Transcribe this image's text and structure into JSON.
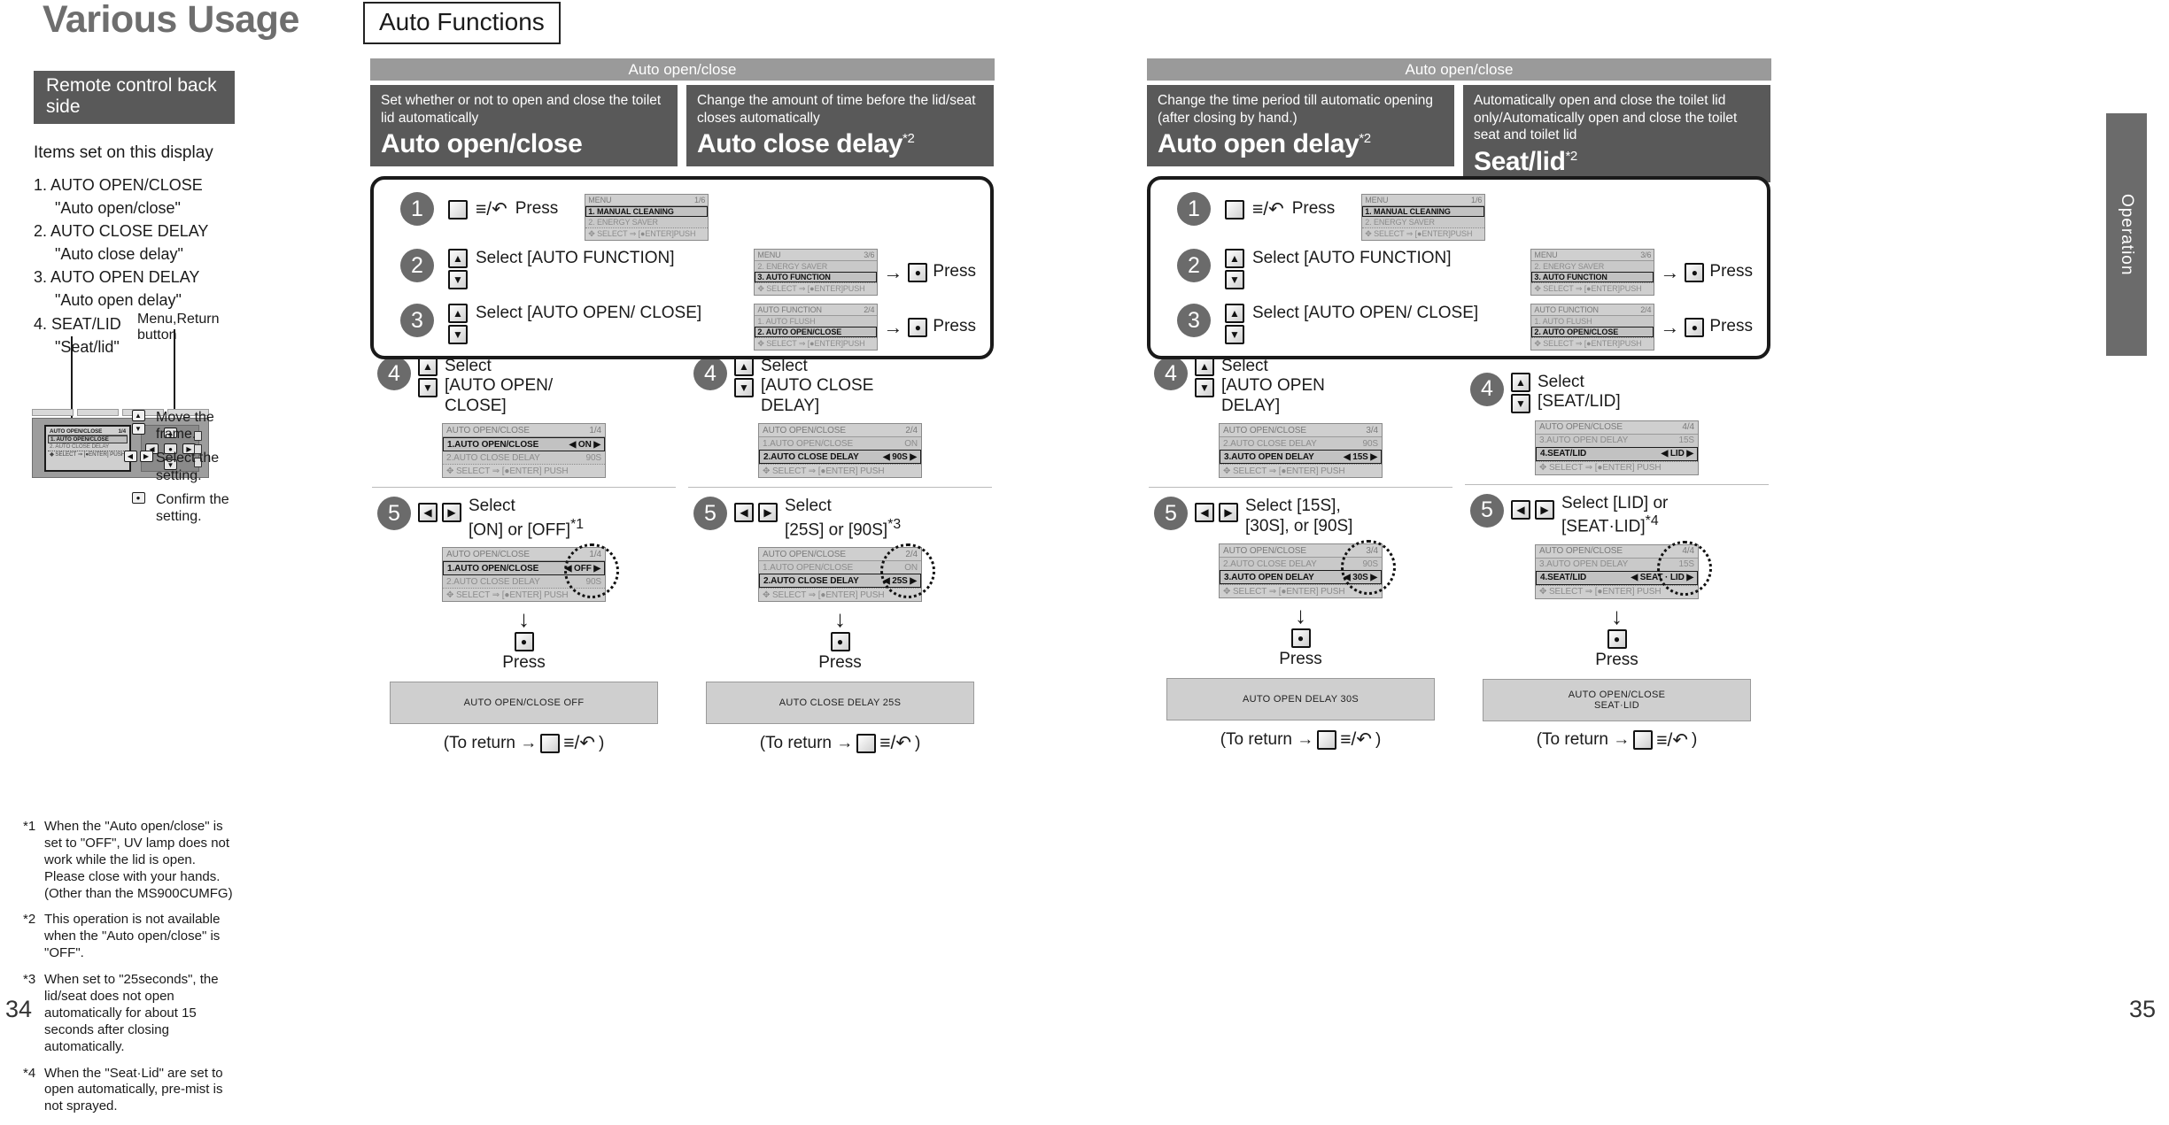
{
  "header": {
    "title": "Various Usage",
    "badge": "Auto Functions"
  },
  "left": {
    "remote_label": "Remote control back side",
    "items_heading": "Items set on this display",
    "items": [
      {
        "num": "1.",
        "code": "AUTO OPEN/CLOSE",
        "alias": "\"Auto open/close\""
      },
      {
        "num": "2.",
        "code": "AUTO CLOSE DELAY",
        "alias": "\"Auto close delay\""
      },
      {
        "num": "3.",
        "code": "AUTO OPEN DELAY",
        "alias": "\"Auto open delay\""
      },
      {
        "num": "4.",
        "code": "SEAT/LID",
        "alias": "\"Seat/lid\""
      }
    ],
    "menu_return_label": "Menu,Return button",
    "remote_lcd": {
      "header_left": "AUTO OPEN/CLOSE",
      "header_right": "1/4",
      "line1": "1. AUTO OPEN/CLOSE",
      "line2": "2. AUTO CLOSE DELAY",
      "footer": "SELECT ⇒ [●ENTER] PUSH"
    },
    "legend": [
      {
        "keys": "updown",
        "text": "Move the frame."
      },
      {
        "keys": "leftright",
        "text": "Select the setting."
      },
      {
        "keys": "enter",
        "text": "Confirm the setting."
      }
    ],
    "footnotes": [
      {
        "mark": "*1",
        "text": "When the \"Auto open/close\" is set to \"OFF\", UV lamp does not work while the lid is open.\nPlease close with your hands.\n(Other than the MS900CUMFG)"
      },
      {
        "mark": "*2",
        "text": "This operation is not available when the \"Auto open/close\" is \"OFF\"."
      },
      {
        "mark": "*3",
        "text": "When set to \"25seconds\", the lid/seat does not open automatically for about 15 seconds after closing automatically."
      },
      {
        "mark": "*4",
        "text": "When the \"Seat·Lid\" are set to open automatically, pre-mist is not sprayed."
      }
    ],
    "page_left": "34",
    "page_right": "35"
  },
  "side_tab": "Operation",
  "shared_steps": {
    "step1": {
      "badge": "1",
      "glyph": "≡/↶",
      "label": "Press"
    },
    "step2": {
      "badge": "2",
      "label": "Select\n[AUTO\nFUNCTION]",
      "press": "Press"
    },
    "step3": {
      "badge": "3",
      "label": "Select\n[AUTO OPEN/\nCLOSE]",
      "press": "Press"
    },
    "lcd1": {
      "hdr_l": "MENU",
      "hdr_r": "1/6",
      "r1": "1. MANUAL CLEANING",
      "r1v": "",
      "r2": "2. ENERGY SAVER",
      "r2v": "",
      "foot": "SELECT ⇒ [●ENTER]PUSH",
      "sel_index": 1
    },
    "lcd2": {
      "hdr_l": "MENU",
      "hdr_r": "3/6",
      "r1": "2. ENERGY SAVER",
      "r1v": "",
      "r2": "3. AUTO FUNCTION",
      "r2v": "",
      "foot": "SELECT ⇒ [●ENTER]PUSH",
      "sel_index": 2
    },
    "lcd3": {
      "hdr_l": "AUTO FUNCTION",
      "hdr_r": "2/4",
      "r1": "1. AUTO FLUSH",
      "r1v": "",
      "r2": "2. AUTO OPEN/CLOSE",
      "r2v": "",
      "foot": "SELECT ⇒ [●ENTER]PUSH",
      "sel_index": 2
    }
  },
  "groups": [
    {
      "bar": "Auto open/close",
      "columns": [
        {
          "desc": "Set whether or not to open and close the toilet lid automatically",
          "name": "Auto open/close",
          "sup": "",
          "step4": {
            "badge": "4",
            "label": "Select\n[AUTO OPEN/\nCLOSE]",
            "lcd": {
              "hdr_l": "AUTO OPEN/CLOSE",
              "hdr_r": "1/4",
              "r1": "1.AUTO OPEN/CLOSE",
              "r1v": "◀ ON ▶",
              "r2": "2.AUTO CLOSE DELAY",
              "r2v": "90S",
              "foot": "SELECT ⇒ [●ENTER] PUSH",
              "sel_index": 1
            }
          },
          "step5": {
            "badge": "5",
            "label": "Select\n[ON] or [OFF]",
            "sup": "*1",
            "lcd": {
              "hdr_l": "AUTO OPEN/CLOSE",
              "hdr_r": "1/4",
              "r1": "1.AUTO OPEN/CLOSE",
              "r1v": "◀ OFF ▶",
              "r2": "2.AUTO CLOSE DELAY",
              "r2v": "90S",
              "foot": "SELECT ⇒ [●ENTER] PUSH",
              "sel_index": 1
            }
          },
          "press": "Press",
          "result": [
            "AUTO OPEN/CLOSE OFF"
          ],
          "to_return": "(To return →",
          "to_return_end": ")"
        },
        {
          "desc": "Change the amount of time before the lid/seat closes automatically",
          "name": "Auto close delay",
          "sup": "*2",
          "step4": {
            "badge": "4",
            "label": "Select\n[AUTO CLOSE\nDELAY]",
            "lcd": {
              "hdr_l": "AUTO OPEN/CLOSE",
              "hdr_r": "2/4",
              "r1": "1.AUTO OPEN/CLOSE",
              "r1v": "ON",
              "r2": "2.AUTO CLOSE DELAY",
              "r2v": "◀ 90S ▶",
              "foot": "SELECT ⇒ [●ENTER] PUSH",
              "sel_index": 2
            }
          },
          "step5": {
            "badge": "5",
            "label": "Select\n[25S] or [90S]",
            "sup": "*3",
            "lcd": {
              "hdr_l": "AUTO OPEN/CLOSE",
              "hdr_r": "2/4",
              "r1": "1.AUTO OPEN/CLOSE",
              "r1v": "ON",
              "r2": "2.AUTO CLOSE DELAY",
              "r2v": "◀ 25S ▶",
              "foot": "SELECT ⇒ [●ENTER] PUSH",
              "sel_index": 2
            }
          },
          "press": "Press",
          "result": [
            "AUTO CLOSE DELAY 25S"
          ],
          "to_return": "(To return →",
          "to_return_end": ")"
        }
      ]
    },
    {
      "bar": "Auto open/close",
      "columns": [
        {
          "desc": "Change the time period till automatic opening (after closing by hand.)",
          "name": "Auto open delay",
          "sup": "*2",
          "step4": {
            "badge": "4",
            "label": "Select\n[AUTO OPEN\nDELAY]",
            "lcd": {
              "hdr_l": "AUTO OPEN/CLOSE",
              "hdr_r": "3/4",
              "r1": "2.AUTO CLOSE DELAY",
              "r1v": "90S",
              "r2": "3.AUTO OPEN DELAY",
              "r2v": "◀ 15S ▶",
              "foot": "SELECT ⇒ [●ENTER] PUSH",
              "sel_index": 2
            }
          },
          "step5": {
            "badge": "5",
            "label": "Select [15S],\n[30S], or [90S]",
            "sup": "",
            "lcd": {
              "hdr_l": "AUTO OPEN/CLOSE",
              "hdr_r": "3/4",
              "r1": "2.AUTO CLOSE DELAY",
              "r1v": "90S",
              "r2": "3.AUTO OPEN DELAY",
              "r2v": "◀ 30S ▶",
              "foot": "SELECT ⇒ [●ENTER] PUSH",
              "sel_index": 2
            }
          },
          "press": "Press",
          "result": [
            "AUTO OPEN DELAY 30S"
          ],
          "to_return": "(To return →",
          "to_return_end": ")"
        },
        {
          "desc": "Automatically open and close the toilet lid only/Automatically open and close the toilet seat and toilet lid",
          "name": "Seat/lid",
          "sup": "*2",
          "step4": {
            "badge": "4",
            "label": "Select\n[SEAT/LID]",
            "lcd": {
              "hdr_l": "AUTO OPEN/CLOSE",
              "hdr_r": "4/4",
              "r1": "3.AUTO OPEN DELAY",
              "r1v": "15S",
              "r2": "4.SEAT/LID",
              "r2v": "◀ LID ▶",
              "foot": "SELECT ⇒ [●ENTER] PUSH",
              "sel_index": 2
            }
          },
          "step5": {
            "badge": "5",
            "label": "Select [LID] or\n[SEAT·LID]",
            "sup": "*4",
            "lcd": {
              "hdr_l": "AUTO OPEN/CLOSE",
              "hdr_r": "4/4",
              "r1": "3.AUTO OPEN DELAY",
              "r1v": "15S",
              "r2": "4.SEAT/LID",
              "r2v": "◀ SEAT · LID ▶",
              "foot": "SELECT ⇒ [●ENTER] PUSH",
              "sel_index": 2
            }
          },
          "press": "Press",
          "result": [
            "AUTO OPEN/CLOSE",
            "SEAT·LID"
          ],
          "to_return": "(To return →",
          "to_return_end": ")"
        }
      ]
    }
  ]
}
